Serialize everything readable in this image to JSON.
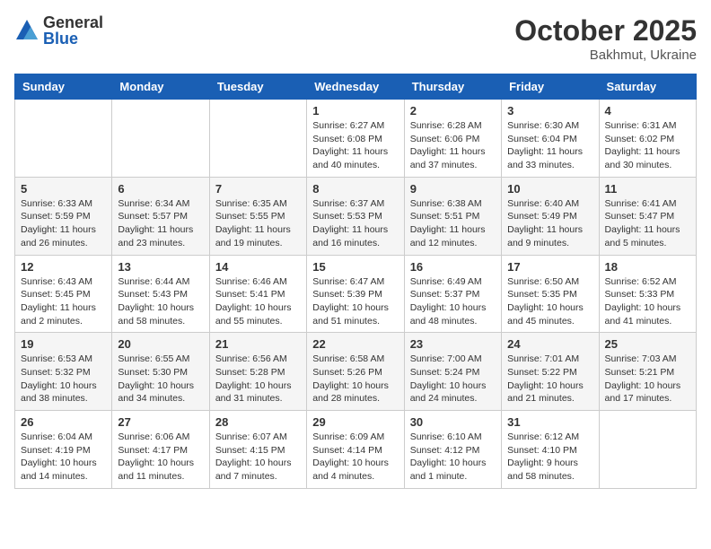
{
  "header": {
    "logo_general": "General",
    "logo_blue": "Blue",
    "month": "October 2025",
    "location": "Bakhmut, Ukraine"
  },
  "weekdays": [
    "Sunday",
    "Monday",
    "Tuesday",
    "Wednesday",
    "Thursday",
    "Friday",
    "Saturday"
  ],
  "weeks": [
    [
      {
        "day": "",
        "info": ""
      },
      {
        "day": "",
        "info": ""
      },
      {
        "day": "",
        "info": ""
      },
      {
        "day": "1",
        "info": "Sunrise: 6:27 AM\nSunset: 6:08 PM\nDaylight: 11 hours\nand 40 minutes."
      },
      {
        "day": "2",
        "info": "Sunrise: 6:28 AM\nSunset: 6:06 PM\nDaylight: 11 hours\nand 37 minutes."
      },
      {
        "day": "3",
        "info": "Sunrise: 6:30 AM\nSunset: 6:04 PM\nDaylight: 11 hours\nand 33 minutes."
      },
      {
        "day": "4",
        "info": "Sunrise: 6:31 AM\nSunset: 6:02 PM\nDaylight: 11 hours\nand 30 minutes."
      }
    ],
    [
      {
        "day": "5",
        "info": "Sunrise: 6:33 AM\nSunset: 5:59 PM\nDaylight: 11 hours\nand 26 minutes."
      },
      {
        "day": "6",
        "info": "Sunrise: 6:34 AM\nSunset: 5:57 PM\nDaylight: 11 hours\nand 23 minutes."
      },
      {
        "day": "7",
        "info": "Sunrise: 6:35 AM\nSunset: 5:55 PM\nDaylight: 11 hours\nand 19 minutes."
      },
      {
        "day": "8",
        "info": "Sunrise: 6:37 AM\nSunset: 5:53 PM\nDaylight: 11 hours\nand 16 minutes."
      },
      {
        "day": "9",
        "info": "Sunrise: 6:38 AM\nSunset: 5:51 PM\nDaylight: 11 hours\nand 12 minutes."
      },
      {
        "day": "10",
        "info": "Sunrise: 6:40 AM\nSunset: 5:49 PM\nDaylight: 11 hours\nand 9 minutes."
      },
      {
        "day": "11",
        "info": "Sunrise: 6:41 AM\nSunset: 5:47 PM\nDaylight: 11 hours\nand 5 minutes."
      }
    ],
    [
      {
        "day": "12",
        "info": "Sunrise: 6:43 AM\nSunset: 5:45 PM\nDaylight: 11 hours\nand 2 minutes."
      },
      {
        "day": "13",
        "info": "Sunrise: 6:44 AM\nSunset: 5:43 PM\nDaylight: 10 hours\nand 58 minutes."
      },
      {
        "day": "14",
        "info": "Sunrise: 6:46 AM\nSunset: 5:41 PM\nDaylight: 10 hours\nand 55 minutes."
      },
      {
        "day": "15",
        "info": "Sunrise: 6:47 AM\nSunset: 5:39 PM\nDaylight: 10 hours\nand 51 minutes."
      },
      {
        "day": "16",
        "info": "Sunrise: 6:49 AM\nSunset: 5:37 PM\nDaylight: 10 hours\nand 48 minutes."
      },
      {
        "day": "17",
        "info": "Sunrise: 6:50 AM\nSunset: 5:35 PM\nDaylight: 10 hours\nand 45 minutes."
      },
      {
        "day": "18",
        "info": "Sunrise: 6:52 AM\nSunset: 5:33 PM\nDaylight: 10 hours\nand 41 minutes."
      }
    ],
    [
      {
        "day": "19",
        "info": "Sunrise: 6:53 AM\nSunset: 5:32 PM\nDaylight: 10 hours\nand 38 minutes."
      },
      {
        "day": "20",
        "info": "Sunrise: 6:55 AM\nSunset: 5:30 PM\nDaylight: 10 hours\nand 34 minutes."
      },
      {
        "day": "21",
        "info": "Sunrise: 6:56 AM\nSunset: 5:28 PM\nDaylight: 10 hours\nand 31 minutes."
      },
      {
        "day": "22",
        "info": "Sunrise: 6:58 AM\nSunset: 5:26 PM\nDaylight: 10 hours\nand 28 minutes."
      },
      {
        "day": "23",
        "info": "Sunrise: 7:00 AM\nSunset: 5:24 PM\nDaylight: 10 hours\nand 24 minutes."
      },
      {
        "day": "24",
        "info": "Sunrise: 7:01 AM\nSunset: 5:22 PM\nDaylight: 10 hours\nand 21 minutes."
      },
      {
        "day": "25",
        "info": "Sunrise: 7:03 AM\nSunset: 5:21 PM\nDaylight: 10 hours\nand 17 minutes."
      }
    ],
    [
      {
        "day": "26",
        "info": "Sunrise: 6:04 AM\nSunset: 4:19 PM\nDaylight: 10 hours\nand 14 minutes."
      },
      {
        "day": "27",
        "info": "Sunrise: 6:06 AM\nSunset: 4:17 PM\nDaylight: 10 hours\nand 11 minutes."
      },
      {
        "day": "28",
        "info": "Sunrise: 6:07 AM\nSunset: 4:15 PM\nDaylight: 10 hours\nand 7 minutes."
      },
      {
        "day": "29",
        "info": "Sunrise: 6:09 AM\nSunset: 4:14 PM\nDaylight: 10 hours\nand 4 minutes."
      },
      {
        "day": "30",
        "info": "Sunrise: 6:10 AM\nSunset: 4:12 PM\nDaylight: 10 hours\nand 1 minute."
      },
      {
        "day": "31",
        "info": "Sunrise: 6:12 AM\nSunset: 4:10 PM\nDaylight: 9 hours\nand 58 minutes."
      },
      {
        "day": "",
        "info": ""
      }
    ]
  ]
}
